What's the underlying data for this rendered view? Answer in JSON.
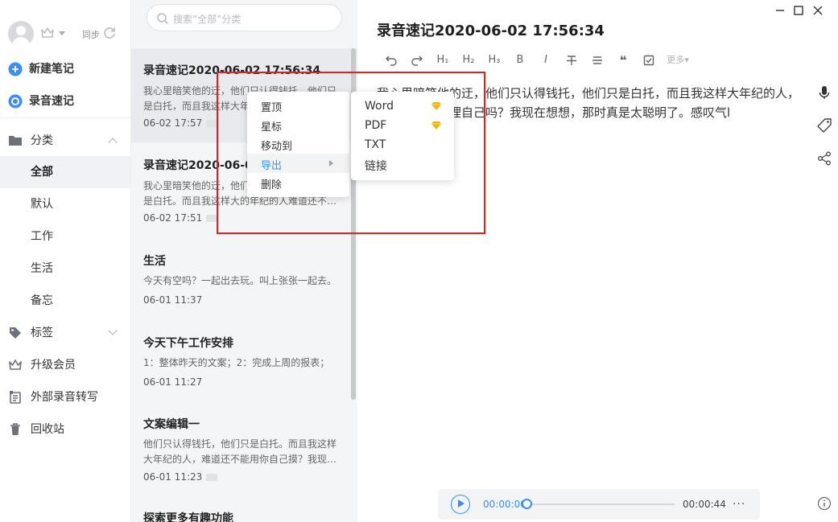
{
  "sidebar": {
    "sync_label": "同步",
    "primary": [
      {
        "label": "新建笔记",
        "icon": "plus-circle-icon"
      },
      {
        "label": "录音速记",
        "icon": "record-icon"
      }
    ],
    "category": {
      "label": "分类",
      "icon": "folder-icon"
    },
    "categories": [
      "全部",
      "默认",
      "工作",
      "生活",
      "备忘"
    ],
    "active_category": "全部",
    "tags": {
      "label": "标签",
      "icon": "tag-icon"
    },
    "bottom": [
      {
        "label": "升级会员",
        "icon": "crown-icon"
      },
      {
        "label": "外部录音转写",
        "icon": "transcribe-icon"
      },
      {
        "label": "回收站",
        "icon": "trash-icon"
      }
    ]
  },
  "notelist": {
    "search_placeholder": "搜索“全部”分类",
    "notes": [
      {
        "title": "录音速记2020-06-02 17:56:34",
        "excerpt": "我心里暗笑他的迂，他们只认得钱托，他们只是白托，而且我这样大年纪的人…",
        "date": "06-02 17:57"
      },
      {
        "title": "录音速记2020-06-02 17:50:47",
        "excerpt": "我心里暗笑他的迂，他们只认得钱托，他们只是白托。而且我这样大的年纪的人难道还不…",
        "date": "06-02 17:51"
      },
      {
        "title": "生活",
        "excerpt": "今天有空吗？一起出去玩。叫上张张一起去。",
        "date": "06-01 11:37"
      },
      {
        "title": "今天下午工作安排",
        "excerpt": "1：整体昨天的文案；2：完成上周的报表；",
        "date": "06-01 11:27"
      },
      {
        "title": "文案编辑一",
        "excerpt": "他们只认得钱托，他们只是白托。而且我这样大年纪的人，难道还不能用你自己摸？我现…",
        "date": "06-01 11:23"
      },
      {
        "title": "探索更多有趣功能",
        "excerpt": "",
        "date": ""
      }
    ]
  },
  "context_menu": {
    "items": [
      "置顶",
      "星标",
      "移动到",
      "导出",
      "删除"
    ],
    "highlighted": "导出"
  },
  "export_menu": {
    "items": [
      {
        "label": "Word",
        "premium": true
      },
      {
        "label": "PDF",
        "premium": true
      },
      {
        "label": "TXT",
        "premium": false
      },
      {
        "label": "链接",
        "premium": false
      }
    ]
  },
  "editor": {
    "title": "录音速记2020-06-02 17:56:34",
    "toolbar": [
      "undo-icon",
      "redo-icon",
      "H1",
      "H2",
      "H3",
      "B",
      "I",
      "strikethrough-icon",
      "align-icon",
      "quote-icon",
      "checkbox-icon"
    ],
    "toolbar_labels": {
      "h1": "H₁",
      "h2": "H₂",
      "h3": "H₃",
      "bold": "B",
      "italic": "I",
      "quote": "❝",
      "more": "更多▾"
    },
    "body": "我心里暗笑他的迂，他们只认得钱托，他们只是白托，而且我这样大年纪的人，难道还不能料理自己吗？我现在想想，那时真是太聪明了。感叹气l",
    "side_tools": [
      "microphone-icon",
      "tag-icon",
      "share-icon"
    ]
  },
  "player": {
    "current_time": "00:00:00",
    "total_time": "00:00:44",
    "progress": 0,
    "more": "···"
  },
  "colors": {
    "accent": "#3a8dfa",
    "highlight_box": "#e02020",
    "premium": "#f5b400"
  }
}
